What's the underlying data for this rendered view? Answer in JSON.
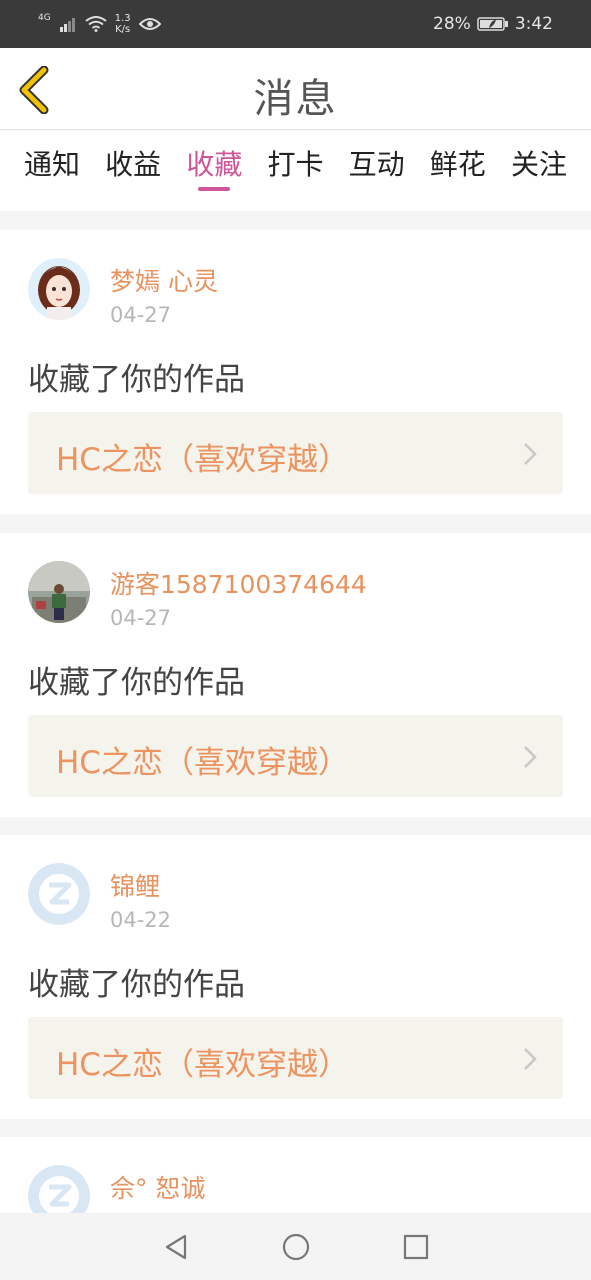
{
  "status_bar": {
    "network": "4G",
    "speed_value": "1.3",
    "speed_unit": "K/s",
    "battery": "28%",
    "time": "3:42"
  },
  "header": {
    "title": "消息"
  },
  "tabs": [
    {
      "label": "通知",
      "active": false
    },
    {
      "label": "收益",
      "active": false
    },
    {
      "label": "收藏",
      "active": true
    },
    {
      "label": "打卡",
      "active": false
    },
    {
      "label": "互动",
      "active": false
    },
    {
      "label": "鲜花",
      "active": false
    },
    {
      "label": "关注",
      "active": false
    }
  ],
  "messages": [
    {
      "user": "梦嫣 心灵",
      "date": "04-27",
      "action": "收藏了你的作品",
      "work": "HC之恋（喜欢穿越）",
      "avatar": "anime-girl-avatar"
    },
    {
      "user": "游客1587100374644",
      "date": "04-27",
      "action": "收藏了你的作品",
      "work": "HC之恋（喜欢穿越）",
      "avatar": "photo-person-avatar"
    },
    {
      "user": "锦鲤",
      "date": "04-22",
      "action": "收藏了你的作品",
      "work": "HC之恋（喜欢穿越）",
      "avatar": "default-z-avatar"
    },
    {
      "user": "佘° 恕诚",
      "avatar": "default-z-avatar"
    }
  ],
  "colors": {
    "accent": "#d0569a",
    "name": "#e8925e",
    "work": "#ec9360",
    "back": "#f2c200"
  }
}
